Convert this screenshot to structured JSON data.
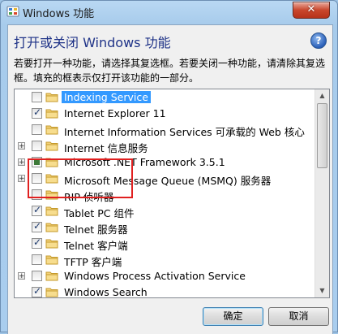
{
  "window": {
    "title": "Windows 功能",
    "close_glyph": "✕",
    "heading": "打开或关闭 Windows 功能",
    "help_glyph": "?",
    "description": "若要打开一种功能，请选择其复选框。若要关闭一种功能，请清除其复选框。填充的框表示仅打开该功能的一部分。"
  },
  "features": [
    {
      "label": "Indexing Service",
      "state": "unchecked",
      "expandable": false,
      "selected": true
    },
    {
      "label": "Internet Explorer 11",
      "state": "checked",
      "expandable": false,
      "selected": false
    },
    {
      "label": "Internet Information Services 可承载的 Web 核心",
      "state": "unchecked",
      "expandable": false,
      "selected": false
    },
    {
      "label": "Internet 信息服务",
      "state": "unchecked",
      "expandable": true,
      "selected": false
    },
    {
      "label": "Microsoft .NET Framework 3.5.1",
      "state": "partial",
      "expandable": true,
      "selected": false
    },
    {
      "label": "Microsoft Message Queue (MSMQ) 服务器",
      "state": "unchecked",
      "expandable": true,
      "selected": false
    },
    {
      "label": "RIP 侦听器",
      "state": "unchecked",
      "expandable": false,
      "selected": false
    },
    {
      "label": "Tablet PC 组件",
      "state": "checked",
      "expandable": false,
      "selected": false
    },
    {
      "label": "Telnet 服务器",
      "state": "checked",
      "expandable": false,
      "selected": false
    },
    {
      "label": "Telnet 客户端",
      "state": "checked",
      "expandable": false,
      "selected": false
    },
    {
      "label": "TFTP 客户端",
      "state": "unchecked",
      "expandable": false,
      "selected": false
    },
    {
      "label": "Windows Process Activation Service",
      "state": "unchecked",
      "expandable": true,
      "selected": false
    },
    {
      "label": "Windows Search",
      "state": "checked",
      "expandable": false,
      "selected": false
    }
  ],
  "buttons": {
    "ok": "确定",
    "cancel": "取消"
  },
  "colors": {
    "heading": "#1e3287",
    "highlight": "#e02020",
    "selection": "#3399ff"
  },
  "icons": {
    "expander": "+",
    "scroll_up": "▲",
    "scroll_down": "▼"
  }
}
